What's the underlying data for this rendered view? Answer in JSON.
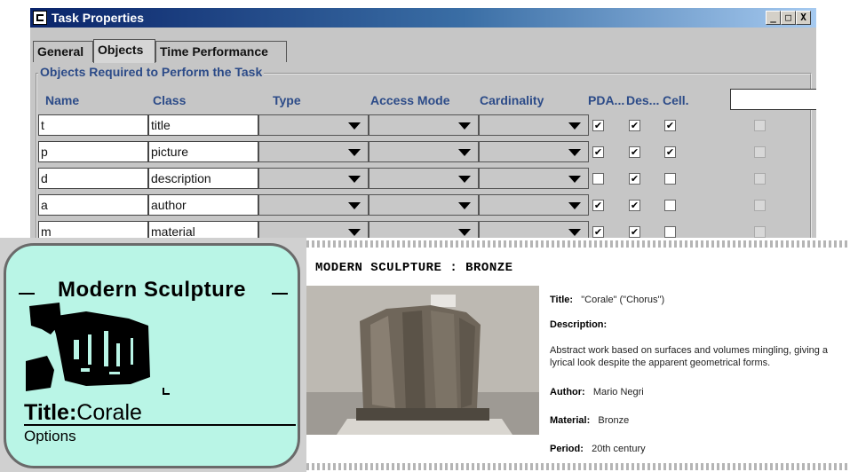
{
  "window": {
    "title": "Task Properties",
    "buttons": {
      "minimize": "_",
      "maximize": "□",
      "close": "X"
    },
    "tabs": [
      "General",
      "Objects",
      "Time Performance"
    ],
    "active_tab": "Objects",
    "group_label": "Objects Required to Perform the Task",
    "columns": [
      "Name",
      "Class",
      "Type",
      "Access Mode",
      "Cardinality",
      "PDA...",
      "Des...",
      "Cell."
    ],
    "rows": [
      {
        "name": "t",
        "class": "title",
        "pda": true,
        "des": true,
        "cell": true
      },
      {
        "name": "p",
        "class": "picture",
        "pda": true,
        "des": true,
        "cell": true
      },
      {
        "name": "d",
        "class": "description",
        "pda": false,
        "des": true,
        "cell": false
      },
      {
        "name": "a",
        "class": "author",
        "pda": true,
        "des": true,
        "cell": false
      },
      {
        "name": "m",
        "class": "material",
        "pda": true,
        "des": true,
        "cell": false
      }
    ]
  },
  "phone": {
    "heading": "Modern Sculpture",
    "caption_label": "Title:",
    "caption_value": "Corale",
    "options_label": "Options"
  },
  "web": {
    "heading": "MODERN SCULPTURE : BRONZE",
    "title_label": "Title:",
    "title_value": "\"Corale\" (\"Chorus\")",
    "description_label": "Description:",
    "description_text": "Abstract work based on surfaces and volumes mingling, giving a lyrical look despite the apparent geometrical forms.",
    "author_label": "Author:",
    "author_value": "Mario Negri",
    "material_label": "Material:",
    "material_value": "Bronze",
    "period_label": "Period:",
    "period_value": "20th century"
  }
}
